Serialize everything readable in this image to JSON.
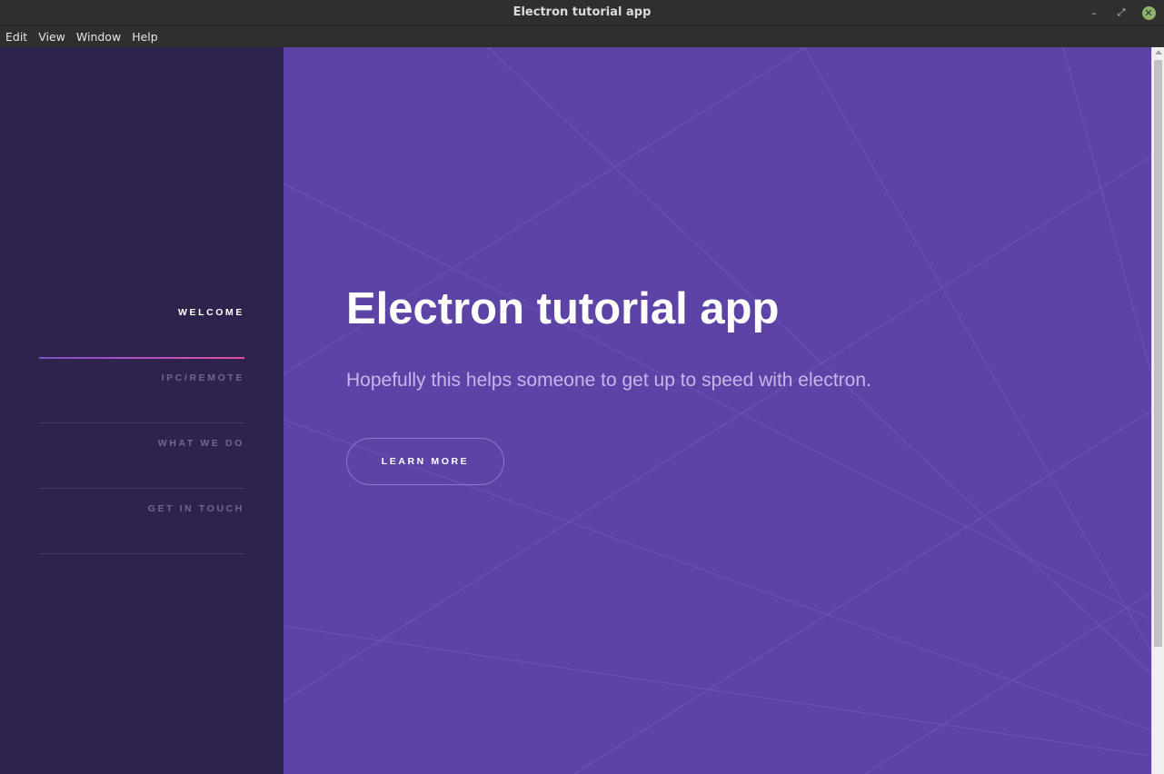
{
  "window": {
    "title": "Electron tutorial app",
    "controls": {
      "minimize": "–",
      "maximize": "⤢",
      "close": "✕"
    }
  },
  "menu": [
    "Edit",
    "View",
    "Window",
    "Help"
  ],
  "sidebar": {
    "items": [
      {
        "label": "WELCOME",
        "active": true
      },
      {
        "label": "IPC/REMOTE",
        "active": false
      },
      {
        "label": "WHAT WE DO",
        "active": false
      },
      {
        "label": "GET IN TOUCH",
        "active": false
      }
    ]
  },
  "hero": {
    "title": "Electron tutorial app",
    "subtitle": "Hopefully this helps someone to get up to speed with electron.",
    "button": "LEARN MORE"
  },
  "colors": {
    "sidebar_bg": "#2e234d",
    "main_bg": "#5d43a6",
    "accent_gradient_start": "#7b4fc9",
    "accent_gradient_end": "#e2509c",
    "close_button": "#8fb26a"
  }
}
